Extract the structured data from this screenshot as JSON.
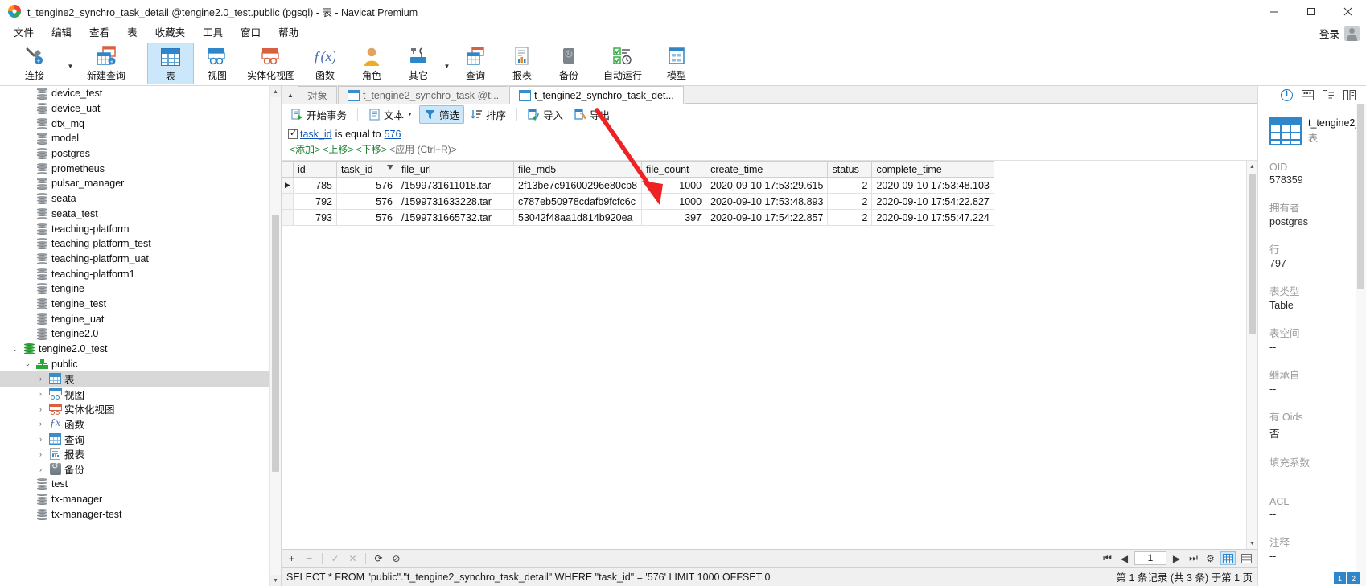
{
  "window": {
    "title": "t_tengine2_synchro_task_detail @tengine2.0_test.public (pgsql) - 表 - Navicat Premium",
    "minimize": "—",
    "maximize": "▢",
    "close": "✕"
  },
  "menubar": {
    "items": [
      "文件",
      "编辑",
      "查看",
      "表",
      "收藏夹",
      "工具",
      "窗口",
      "帮助"
    ],
    "login_label": "登录"
  },
  "toolbar": {
    "items": [
      {
        "label": "连接",
        "icon": "connection-icon",
        "has_dropdown": true
      },
      {
        "label": "新建查询",
        "icon": "new-query-icon",
        "has_dropdown": false
      },
      {
        "label": "表",
        "icon": "table-icon",
        "selected": true
      },
      {
        "label": "视图",
        "icon": "view-icon"
      },
      {
        "label": "实体化视图",
        "icon": "materialized-view-icon"
      },
      {
        "label": "函数",
        "icon": "function-icon"
      },
      {
        "label": "角色",
        "icon": "role-icon"
      },
      {
        "label": "其它",
        "icon": "other-icon",
        "has_dropdown": true
      },
      {
        "label": "查询",
        "icon": "query-icon"
      },
      {
        "label": "报表",
        "icon": "report-icon"
      },
      {
        "label": "备份",
        "icon": "backup-icon"
      },
      {
        "label": "自动运行",
        "icon": "automation-icon"
      },
      {
        "label": "模型",
        "icon": "model-icon"
      }
    ]
  },
  "sidebar": {
    "items": [
      {
        "label": "device_test",
        "icon": "database-icon",
        "indent": 1,
        "expander": "",
        "state": ""
      },
      {
        "label": "device_uat",
        "icon": "database-icon",
        "indent": 1,
        "expander": "",
        "state": ""
      },
      {
        "label": "dtx_mq",
        "icon": "database-icon",
        "indent": 1,
        "expander": "",
        "state": ""
      },
      {
        "label": "model",
        "icon": "database-icon",
        "indent": 1,
        "expander": "",
        "state": ""
      },
      {
        "label": "postgres",
        "icon": "database-icon",
        "indent": 1,
        "expander": "",
        "state": ""
      },
      {
        "label": "prometheus",
        "icon": "database-icon",
        "indent": 1,
        "expander": "",
        "state": ""
      },
      {
        "label": "pulsar_manager",
        "icon": "database-icon",
        "indent": 1,
        "expander": "",
        "state": ""
      },
      {
        "label": "seata",
        "icon": "database-icon",
        "indent": 1,
        "expander": "",
        "state": ""
      },
      {
        "label": "seata_test",
        "icon": "database-icon",
        "indent": 1,
        "expander": "",
        "state": ""
      },
      {
        "label": "teaching-platform",
        "icon": "database-icon",
        "indent": 1,
        "expander": "",
        "state": ""
      },
      {
        "label": "teaching-platform_test",
        "icon": "database-icon",
        "indent": 1,
        "expander": "",
        "state": ""
      },
      {
        "label": "teaching-platform_uat",
        "icon": "database-icon",
        "indent": 1,
        "expander": "",
        "state": ""
      },
      {
        "label": "teaching-platform1",
        "icon": "database-icon",
        "indent": 1,
        "expander": "",
        "state": ""
      },
      {
        "label": "tengine",
        "icon": "database-icon",
        "indent": 1,
        "expander": "",
        "state": ""
      },
      {
        "label": "tengine_test",
        "icon": "database-icon",
        "indent": 1,
        "expander": "",
        "state": ""
      },
      {
        "label": "tengine_uat",
        "icon": "database-icon",
        "indent": 1,
        "expander": "",
        "state": ""
      },
      {
        "label": "tengine2.0",
        "icon": "database-icon",
        "indent": 1,
        "expander": "",
        "state": ""
      },
      {
        "label": "tengine2.0_test",
        "icon": "database-open-icon",
        "indent": 0,
        "expander": "⌄",
        "state": "expanded"
      },
      {
        "label": "public",
        "icon": "schema-icon",
        "indent": 1,
        "expander": "⌄",
        "state": "expanded"
      },
      {
        "label": "表",
        "icon": "table-icon",
        "indent": 2,
        "expander": "›",
        "state": "selected"
      },
      {
        "label": "视图",
        "icon": "view-icon",
        "indent": 2,
        "expander": "›",
        "state": ""
      },
      {
        "label": "实体化视图",
        "icon": "materialized-view-icon",
        "indent": 2,
        "expander": "›",
        "state": ""
      },
      {
        "label": "函数",
        "icon": "function-icon",
        "indent": 2,
        "expander": "›",
        "state": ""
      },
      {
        "label": "查询",
        "icon": "query-icon",
        "indent": 2,
        "expander": "›",
        "state": ""
      },
      {
        "label": "报表",
        "icon": "report-icon",
        "indent": 2,
        "expander": "›",
        "state": ""
      },
      {
        "label": "备份",
        "icon": "backup-icon",
        "indent": 2,
        "expander": "›",
        "state": ""
      },
      {
        "label": "test",
        "icon": "database-icon",
        "indent": 1,
        "expander": "",
        "state": ""
      },
      {
        "label": "tx-manager",
        "icon": "database-icon",
        "indent": 1,
        "expander": "",
        "state": ""
      },
      {
        "label": "tx-manager-test",
        "icon": "database-icon",
        "indent": 1,
        "expander": "",
        "state": ""
      }
    ]
  },
  "tabs": {
    "collapse_icon": "chevron-up-icon",
    "items": [
      {
        "label": "对象",
        "icon": "",
        "active": false
      },
      {
        "label": "t_tengine2_synchro_task @t...",
        "icon": "table-icon",
        "active": false
      },
      {
        "label": "t_tengine2_synchro_task_det...",
        "icon": "table-icon",
        "active": true
      }
    ]
  },
  "subtoolbar": {
    "begin_transaction": "开始事务",
    "text": "文本",
    "filter": "筛选",
    "sort": "排序",
    "import": "导入",
    "export": "导出"
  },
  "filter": {
    "checked": true,
    "field": "task_id",
    "operator": "is equal to",
    "value": "576",
    "actions": [
      "<添加>",
      "<上移>",
      "<下移>",
      "<应用 (Ctrl+R)>"
    ]
  },
  "grid": {
    "columns": [
      "id",
      "task_id",
      "file_url",
      "file_md5",
      "file_count",
      "create_time",
      "status",
      "complete_time"
    ],
    "filter_column": "task_id",
    "rows": [
      {
        "marker": "▶",
        "selected": true,
        "id": "785",
        "task_id": "576",
        "file_url": "/1599731611018.tar",
        "file_md5": "2f13be7c91600296e80cb8",
        "file_count": "1000",
        "create_time": "2020-09-10 17:53:29.615",
        "status": "2",
        "complete_time": "2020-09-10 17:53:48.103"
      },
      {
        "marker": "",
        "selected": false,
        "id": "792",
        "task_id": "576",
        "file_url": "/1599731633228.tar",
        "file_md5": "c787eb50978cdafb9fcfc6c",
        "file_count": "1000",
        "create_time": "2020-09-10 17:53:48.893",
        "status": "2",
        "complete_time": "2020-09-10 17:54:22.827"
      },
      {
        "marker": "",
        "selected": false,
        "id": "793",
        "task_id": "576",
        "file_url": "/1599731665732.tar",
        "file_md5": "53042f48aa1d814b920ea",
        "file_count": "397",
        "create_time": "2020-09-10 17:54:22.857",
        "status": "2",
        "complete_time": "2020-09-10 17:55:47.224"
      }
    ]
  },
  "gridfooter": {
    "add_icon": "+",
    "remove_icon": "−",
    "confirm_icon": "✓",
    "cancel_icon": "✕",
    "refresh_icon": "⟳",
    "stop_icon": "⊘",
    "first_icon": "⏮",
    "prev_icon": "◀",
    "page_value": "1",
    "next_icon": "▶",
    "last_icon": "⏭",
    "settings_icon": "⚙",
    "grid_view_icon": "grid-view-icon",
    "form_view_icon": "form-view-icon"
  },
  "statusbar": {
    "sql": "SELECT * FROM \"public\".\"t_tengine2_synchro_task_detail\" WHERE \"task_id\" = '576' LIMIT 1000 OFFSET 0",
    "record_info": "第 1 条记录 (共 3 条) 于第 1 页"
  },
  "infopanel": {
    "tabs": [
      "info-icon",
      "properties-icon",
      "ddl-icon",
      "preview-icon"
    ],
    "title": "t_tengine2_...",
    "subtitle": "表",
    "fields": [
      {
        "key": "OID",
        "value": "578359"
      },
      {
        "key": "拥有者",
        "value": "postgres"
      },
      {
        "key": "行",
        "value": "797"
      },
      {
        "key": "表类型",
        "value": "Table"
      },
      {
        "key": "表空间",
        "value": "--"
      },
      {
        "key": "继承自",
        "value": "--"
      },
      {
        "key": "有 Oids",
        "value": "否"
      },
      {
        "key": "填充系数",
        "value": "--"
      },
      {
        "key": "ACL",
        "value": "--"
      },
      {
        "key": "注释",
        "value": "--"
      }
    ]
  },
  "annotation": {
    "arrow_color": "#ee2222"
  },
  "colors": {
    "accent": "#2f86c8",
    "selection": "#1579c8",
    "link": "#1157b5",
    "filter_action": "#1a7f2f"
  }
}
